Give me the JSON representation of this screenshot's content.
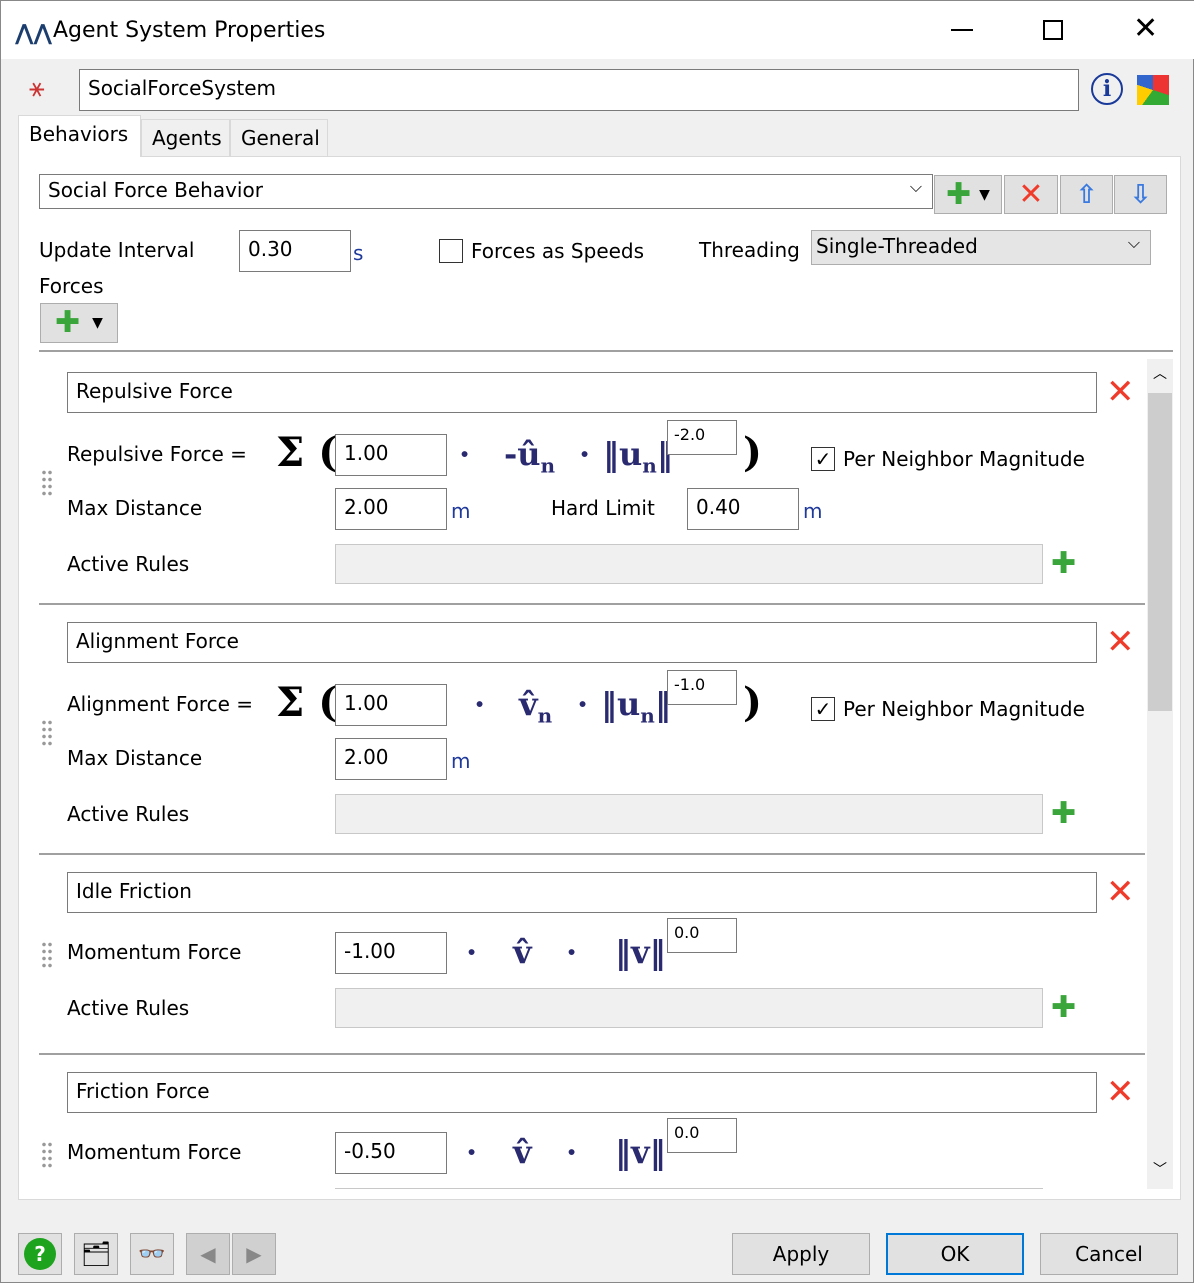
{
  "window": {
    "title": "Agent System Properties",
    "app_icon": "flexsim-logo-icon",
    "controls": [
      "minimize",
      "maximize",
      "close"
    ]
  },
  "header": {
    "name_value": "SocialForceSystem",
    "icons": [
      "agent-system-icon",
      "info-icon",
      "statistics-icon"
    ]
  },
  "tabs": [
    {
      "label": "Behaviors",
      "active": true
    },
    {
      "label": "Agents"
    },
    {
      "label": "General"
    }
  ],
  "behaviors": {
    "selected_behavior": "Social Force Behavior",
    "update_interval_label": "Update Interval",
    "update_interval_value": "0.30",
    "update_interval_unit": "s",
    "forces_as_speeds_label": "Forces as Speeds",
    "forces_as_speeds_checked": false,
    "threading_label": "Threading",
    "threading_value": "Single-Threaded",
    "forces_label": "Forces"
  },
  "forces": [
    {
      "name": "Repulsive Force",
      "formula_label": "Repulsive Force =",
      "coefficient": "1.00",
      "vector": "-û",
      "norm": "u",
      "sub": "n",
      "exponent": "-2.0",
      "per_neighbor_label": "Per Neighbor Magnitude",
      "per_neighbor_checked": true,
      "max_distance_label": "Max Distance",
      "max_distance": "2.00",
      "unit": "m",
      "hard_limit_label": "Hard Limit",
      "hard_limit": "0.40",
      "active_rules_label": "Active Rules"
    },
    {
      "name": "Alignment Force",
      "formula_label": "Alignment Force =",
      "coefficient": "1.00",
      "vector": "v̂",
      "norm": "u",
      "sub": "n",
      "exponent": "-1.0",
      "per_neighbor_label": "Per Neighbor Magnitude",
      "per_neighbor_checked": true,
      "max_distance_label": "Max Distance",
      "max_distance": "2.00",
      "unit": "m",
      "active_rules_label": "Active Rules"
    },
    {
      "name": "Idle Friction",
      "formula_label": "Momentum Force",
      "coefficient": "-1.00",
      "vector": "v̂",
      "norm": "v",
      "exponent": "0.0",
      "active_rules_label": "Active Rules"
    },
    {
      "name": "Friction Force",
      "formula_label": "Momentum Force",
      "coefficient": "-0.50",
      "vector": "v̂",
      "norm": "v",
      "exponent": "0.0"
    }
  ],
  "footer": {
    "apply": "Apply",
    "ok": "OK",
    "cancel": "Cancel"
  },
  "colors": {
    "accent_blue": "#2a2a70",
    "delete_red": "#f03a2a",
    "add_green": "#3aa53a"
  }
}
